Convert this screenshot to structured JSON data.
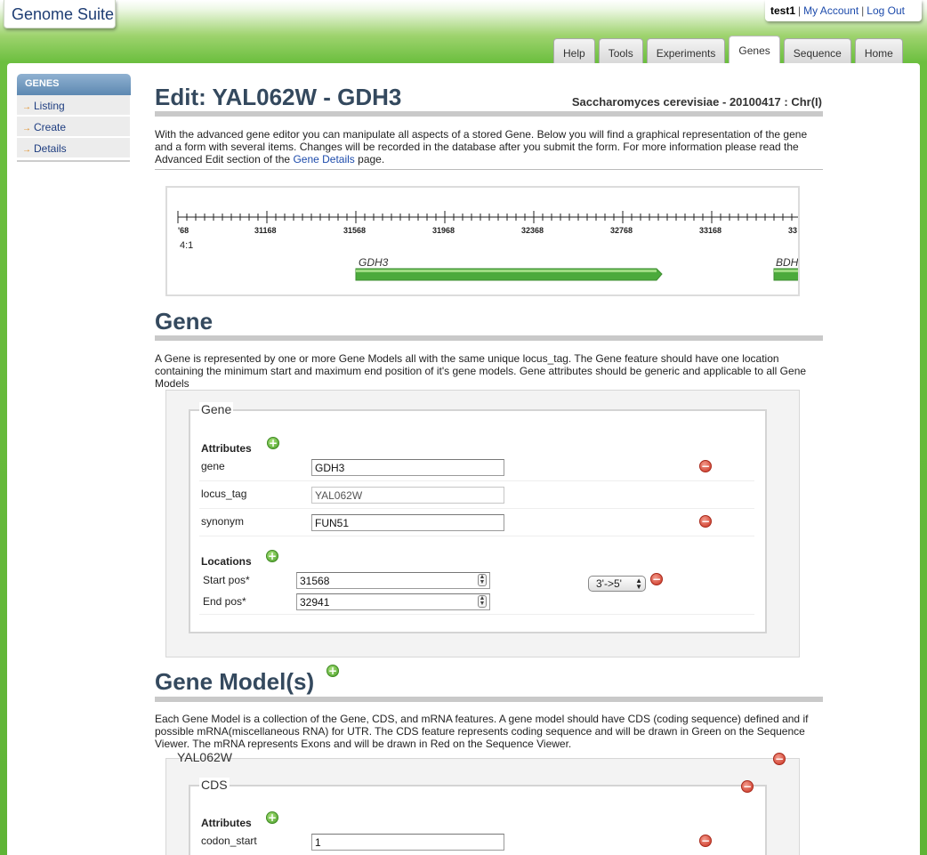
{
  "app": {
    "title": "Genome Suite"
  },
  "account": {
    "user": "test1",
    "my_account": "My Account",
    "logout": "Log Out",
    "sep": "|"
  },
  "tabs": [
    {
      "label": "Help"
    },
    {
      "label": "Tools"
    },
    {
      "label": "Experiments"
    },
    {
      "label": "Genes",
      "active": true
    },
    {
      "label": "Sequence"
    },
    {
      "label": "Home"
    }
  ],
  "sidebar": {
    "header": "GENES",
    "arrow": "→",
    "items": [
      {
        "label": "Listing"
      },
      {
        "label": "Create"
      },
      {
        "label": "Details"
      }
    ]
  },
  "page": {
    "title": "Edit: YAL062W - GDH3",
    "organism": "Saccharomyces cerevisiae - 20100417 : Chr(I)",
    "intro_1": "With the advanced gene editor you can manipulate all aspects of a stored Gene. Below you will find a graphical representation of the gene",
    "intro_2": "and a form with several items. Changes will be recorded in the database after you submit the form. For more information please read the",
    "intro_3a": "Advanced Edit section of the ",
    "intro_link": "Gene Details",
    "intro_3b": " page."
  },
  "viewer": {
    "ticks": [
      "'68",
      "31168",
      "31568",
      "31968",
      "32368",
      "32768",
      "33168",
      "33"
    ],
    "strand_label": "4:1",
    "features": [
      {
        "name": "GDH3"
      },
      {
        "name": "BDH"
      }
    ]
  },
  "gene": {
    "heading": "Gene",
    "desc_1": "A Gene is represented by one or more Gene Models all with the same unique locus_tag. The Gene feature should have one location",
    "desc_2": "containing the minimum start and maximum end position of it's gene models. Gene attributes should be generic and applicable to all Gene",
    "desc_3": "Models",
    "legend": "Gene",
    "attributes_label": "Attributes",
    "attributes": [
      {
        "key": "gene",
        "value": "GDH3"
      },
      {
        "key": "locus_tag",
        "value": "YAL062W"
      },
      {
        "key": "synonym",
        "value": "FUN51"
      }
    ],
    "locations_label": "Locations",
    "start_label": "Start pos*",
    "start_value": "31568",
    "end_label": "End pos*",
    "end_value": "32941",
    "strand_value": "3'->5'"
  },
  "gene_models": {
    "heading": "Gene Model(s)",
    "desc_1": "Each Gene Model is a collection of the Gene, CDS, and mRNA features. A gene model should have CDS (coding sequence) defined and if",
    "desc_2": "possible mRNA(miscellaneous RNA) for UTR. The CDS feature represents coding sequence and will be drawn in Green on the Sequence",
    "desc_3": "Viewer. The mRNA represents Exons and will be drawn in Red on the Sequence Viewer.",
    "model_legend": "YAL062W",
    "cds_legend": "CDS",
    "attributes_label": "Attributes",
    "codon_key": "codon_start",
    "codon_value": "1"
  },
  "icons": {
    "plus": "+",
    "minus": "−",
    "up": "▲",
    "down": "▼"
  },
  "colors": {
    "accent_green": "#6cbf3f",
    "title": "#34495e",
    "link": "#1d4bab",
    "feature_green": "#4caa3c"
  }
}
